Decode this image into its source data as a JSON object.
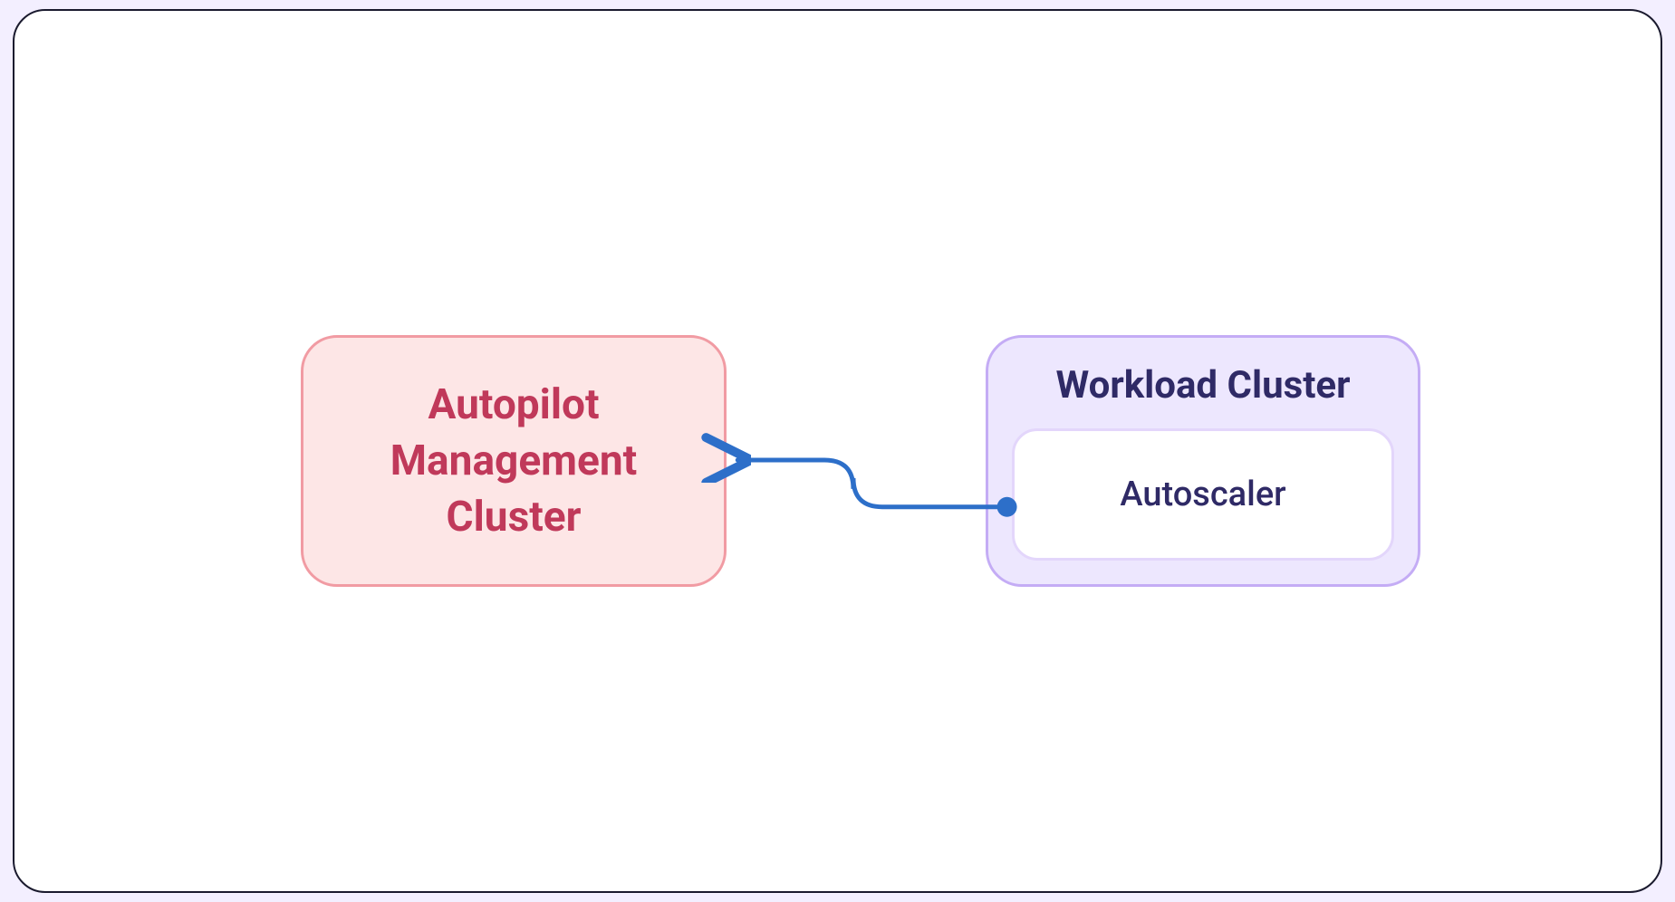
{
  "nodes": {
    "autopilot": {
      "title": "Autopilot\nManagement\nCluster"
    },
    "workload": {
      "title": "Workload Cluster",
      "inner": {
        "autoscaler": "Autoscaler"
      }
    }
  },
  "edge": {
    "from": "autoscaler",
    "to": "autopilot",
    "direction": "right-to-left"
  },
  "colors": {
    "canvas_border": "#1a1a2e",
    "autopilot_fill": "#fde6e6",
    "autopilot_border": "#f19ba3",
    "autopilot_text": "#c0395a",
    "workload_fill": "#ede7fe",
    "workload_border": "#c4acf5",
    "workload_text": "#2f2a66",
    "autoscaler_fill": "#ffffff",
    "autoscaler_border": "#e3d6fb",
    "connector": "#2d6fc9"
  }
}
